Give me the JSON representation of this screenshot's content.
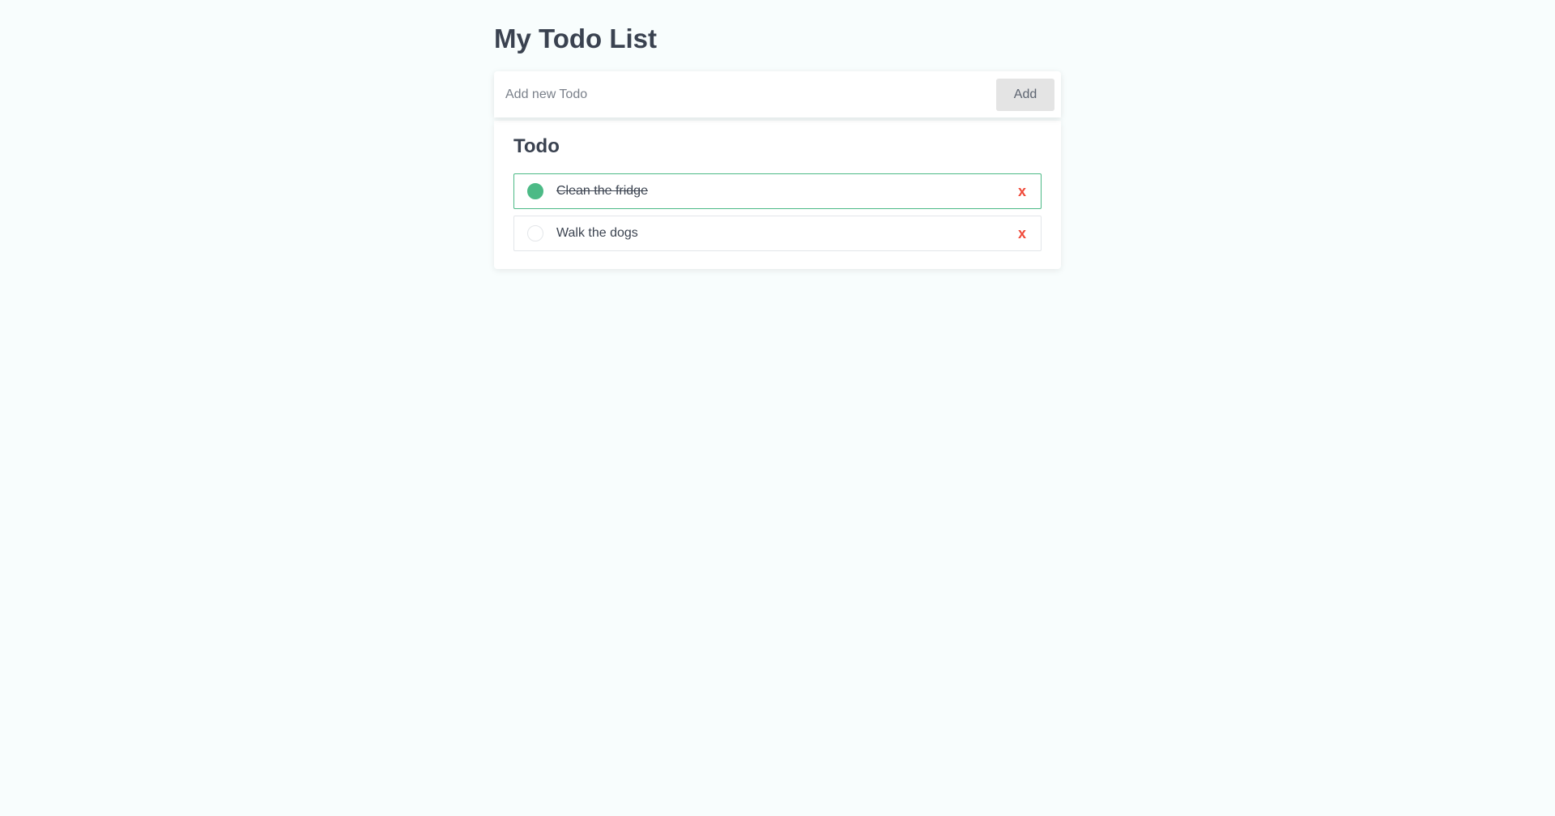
{
  "header": {
    "title": "My Todo List"
  },
  "add_form": {
    "input_value": "",
    "input_placeholder": "Add new Todo",
    "add_label": "Add"
  },
  "list": {
    "section_title": "Todo",
    "items": [
      {
        "text": "Clean the fridge",
        "done": true,
        "delete_label": "x"
      },
      {
        "text": "Walk the dogs",
        "done": false,
        "delete_label": "x"
      }
    ]
  },
  "colors": {
    "accent_green": "#4cba86",
    "delete_red": "#f04a3a",
    "text_dark": "#3a4250",
    "background": "#f8fdfd"
  },
  "icons": {
    "complete_toggle": "circle-check-icon",
    "delete": "close-icon"
  }
}
